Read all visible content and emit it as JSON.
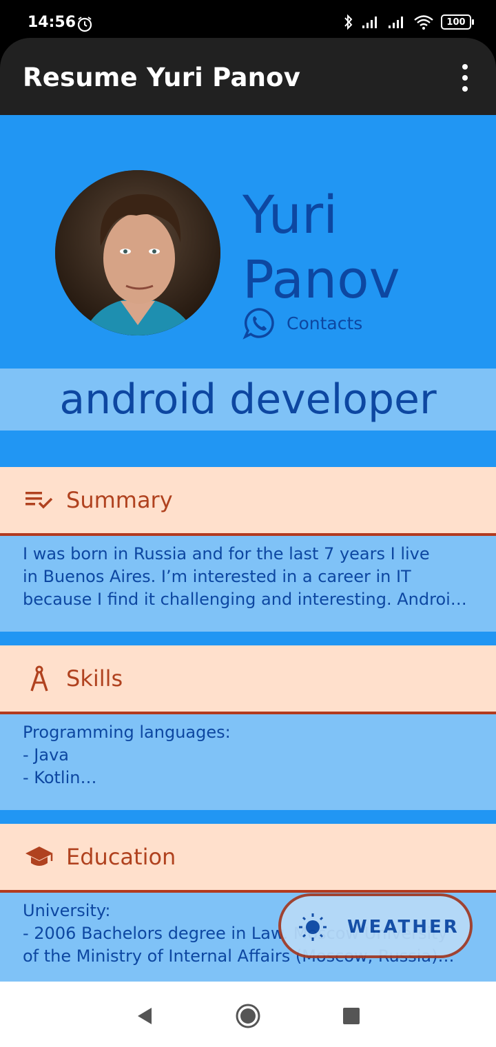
{
  "status_bar": {
    "time": "14:56",
    "battery": "100",
    "icons": [
      "alarm-icon",
      "bluetooth-icon",
      "signal-icon",
      "signal-icon",
      "wifi-icon",
      "battery-icon"
    ]
  },
  "app_bar": {
    "title": "Resume Yuri Panov",
    "menu_icon": "overflow-menu-icon"
  },
  "profile": {
    "first_name": "Yuri",
    "last_name": "Panov",
    "contacts_label": "Contacts",
    "contacts_icon": "whatsapp-icon",
    "role": "android developer"
  },
  "sections": [
    {
      "title": "Summary",
      "icon": "checklist-icon",
      "lines": [
        "I was born in Russia and for the last 7 years I live",
        "in Buenos Aires. I’m interested in a career in IT",
        "because I find it challenging and interesting. Androi…"
      ]
    },
    {
      "title": "Skills",
      "icon": "compass-icon",
      "lines": [
        "Programming languages:",
        "- Java",
        "- Kotlin…"
      ]
    },
    {
      "title": "Education",
      "icon": "graduation-cap-icon",
      "lines": [
        "University:",
        "- 2006 Bachelors degree in Law. Moscow University",
        "of the Ministry of Internal Affairs (Moscow, Russia)…"
      ]
    }
  ],
  "fab": {
    "label": "WEATHER",
    "icon": "sun-icon"
  },
  "colors": {
    "app_bar": "#212121",
    "background": "#2196F3",
    "band": "#7FC2F7",
    "section_header": "#FFE0CC",
    "accent": "#B0421F",
    "text_dark_blue": "#0D47A1"
  }
}
